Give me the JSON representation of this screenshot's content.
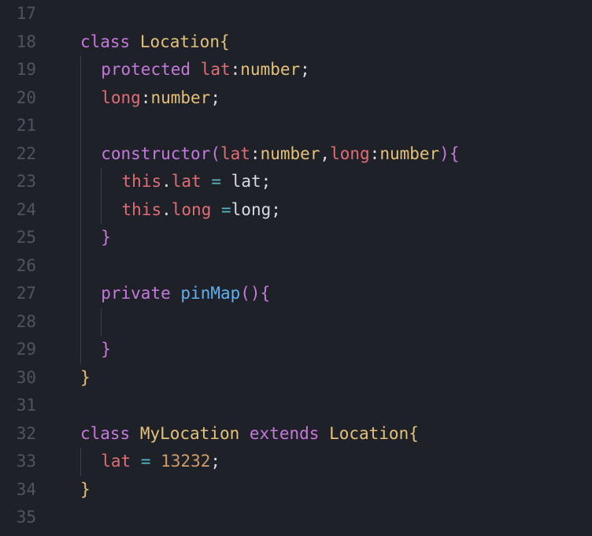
{
  "lineNumbers": [
    "17",
    "18",
    "19",
    "20",
    "21",
    "22",
    "23",
    "24",
    "25",
    "26",
    "27",
    "28",
    "29",
    "30",
    "31",
    "32",
    "33",
    "34",
    "35"
  ],
  "tokens": {
    "class": "class",
    "Location": "Location",
    "protected": "protected",
    "lat": "lat",
    "long": "long",
    "number": "number",
    "constructor": "constructor",
    "this": "this",
    "private": "private",
    "pinMap": "pinMap",
    "MyLocation": "MyLocation",
    "extends": "extends",
    "value": "13232",
    "colon": ":",
    "semi": ";",
    "comma": ",",
    "dot": ".",
    "eq": "=",
    "lparen": "(",
    "rparen": ")",
    "lbrace": "{",
    "rbrace": "}",
    "space": " "
  }
}
